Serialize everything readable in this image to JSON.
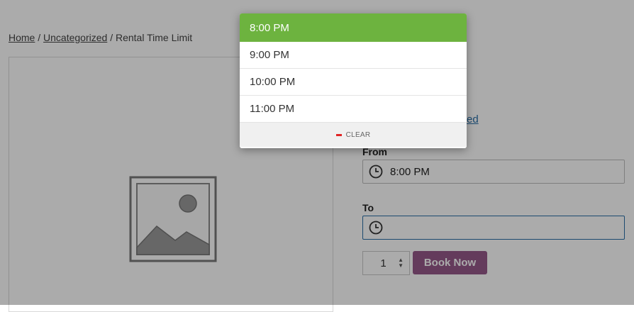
{
  "breadcrumb": {
    "home": "Home",
    "sep1": " / ",
    "category": "Uncategorized",
    "sep2": " / ",
    "current": "Rental Time Limit"
  },
  "partial_link_text": "ed",
  "from": {
    "label": "From",
    "value": "8:00 PM",
    "icon": "clock-icon"
  },
  "to": {
    "label": "To",
    "value": "",
    "icon": "clock-icon"
  },
  "quantity": "1",
  "book_button": "Book Now",
  "time_dropdown": {
    "options": [
      "8:00 PM",
      "9:00 PM",
      "10:00 PM",
      "11:00 PM"
    ],
    "selected": "8:00 PM",
    "clear_label": "CLEAR"
  },
  "colors": {
    "selected_bg": "#6db33f",
    "book_button_bg": "#96588a",
    "clear_icon": "#e02424"
  }
}
